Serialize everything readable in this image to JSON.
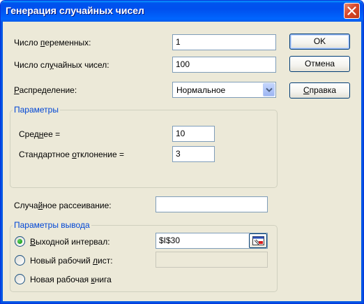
{
  "window": {
    "title": "Генерация случайных чисел",
    "close_icon": "close-icon"
  },
  "fields": {
    "variables": {
      "label_before": "Число ",
      "label_accel": "п",
      "label_after": "еременных:",
      "value": "1"
    },
    "count": {
      "label_before": "Число сл",
      "label_accel": "у",
      "label_after": "чайных чисел:",
      "value": "100"
    },
    "distribution": {
      "label_before": "",
      "label_accel": "Р",
      "label_after": "аспределение:",
      "value": "Нормальное",
      "icon": "chevron-down-icon"
    }
  },
  "params_group": {
    "title": "Параметры",
    "mean": {
      "label_before": "Сред",
      "label_accel": "н",
      "label_after": "ее =",
      "value": "10"
    },
    "stdev": {
      "label_before": "Стандартное ",
      "label_accel": "о",
      "label_after": "тклонение =",
      "value": "3"
    }
  },
  "seed": {
    "label_before": "Случа",
    "label_accel": "й",
    "label_after": "ное рассеивание:",
    "value": ""
  },
  "output_group": {
    "title": "Параметры вывода",
    "range": {
      "label_before": "",
      "label_accel": "В",
      "label_after": "ыходной интервал:",
      "value": "$I$30",
      "selected": true,
      "icon": "collapse-dialog-icon"
    },
    "new_sheet": {
      "label_before": "Новый рабочий ",
      "label_accel": "л",
      "label_after": "ист:",
      "value": "",
      "selected": false
    },
    "new_book": {
      "label_before": "Новая рабочая ",
      "label_accel": "к",
      "label_after": "нига",
      "selected": false
    }
  },
  "buttons": {
    "ok": "OK",
    "cancel": "Отмена",
    "help_before": "",
    "help_accel": "С",
    "help_after": "правка"
  },
  "colors": {
    "title_bar": "#0054e3",
    "dialog_bg": "#ece9d8",
    "group_title": "#0046d5",
    "close_button": "#d8472a"
  }
}
